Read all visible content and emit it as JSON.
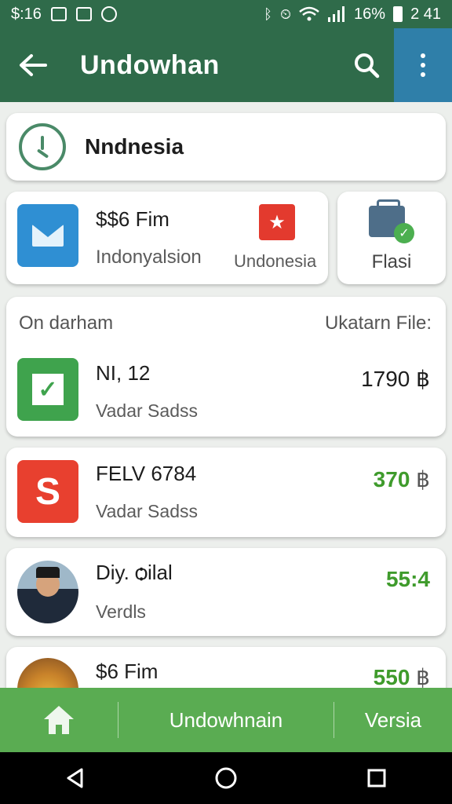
{
  "status_bar": {
    "time_left": "$:16",
    "battery": "16%",
    "time_right": "2 41"
  },
  "app_bar": {
    "title": "Undowhan",
    "back_icon": "arrow-left-icon",
    "search_icon": "search-icon",
    "more_icon": "more-vertical-icon",
    "color": "#2f6b4a",
    "more_bg": "#2f7fa9"
  },
  "location_card": {
    "icon": "clock-icon",
    "label": "Nndnesia"
  },
  "summary_card": {
    "icon": "mail-icon",
    "title": "$$6 Fim",
    "subtitle": "Indonyalsion",
    "flag_icon": "star-flag-icon",
    "flag_label": "Undonesia"
  },
  "flasi_card": {
    "icon": "document-check-icon",
    "label": "Flasi"
  },
  "list": {
    "header_left": "On darham",
    "header_right": "Ukatarn File:",
    "items": [
      {
        "icon": "check-icon",
        "name": "NI, 12",
        "sub": "Vadar Sadss",
        "amount": "1790",
        "currency": "฿"
      },
      {
        "icon": "s-logo-icon",
        "name": "FELV 6784",
        "sub": "Vadar Sadss",
        "amount": "370",
        "currency": "฿"
      },
      {
        "icon": "avatar-person",
        "name": "Diy. ѻilal",
        "sub": "Verdls",
        "amount": "55:4",
        "currency": ""
      },
      {
        "icon": "avatar-food",
        "name": "$6 Fim",
        "sub": "",
        "amount": "550",
        "currency": "฿"
      }
    ],
    "amount_green": "#3f9b2c"
  },
  "bottom_nav": {
    "home_icon": "home-icon",
    "tab1": "Undowhnain",
    "tab2": "Versia",
    "color": "#5aac52"
  },
  "system_nav": {
    "back_icon": "triangle-back-icon",
    "home_icon": "circle-home-icon",
    "recents_icon": "square-recents-icon"
  }
}
